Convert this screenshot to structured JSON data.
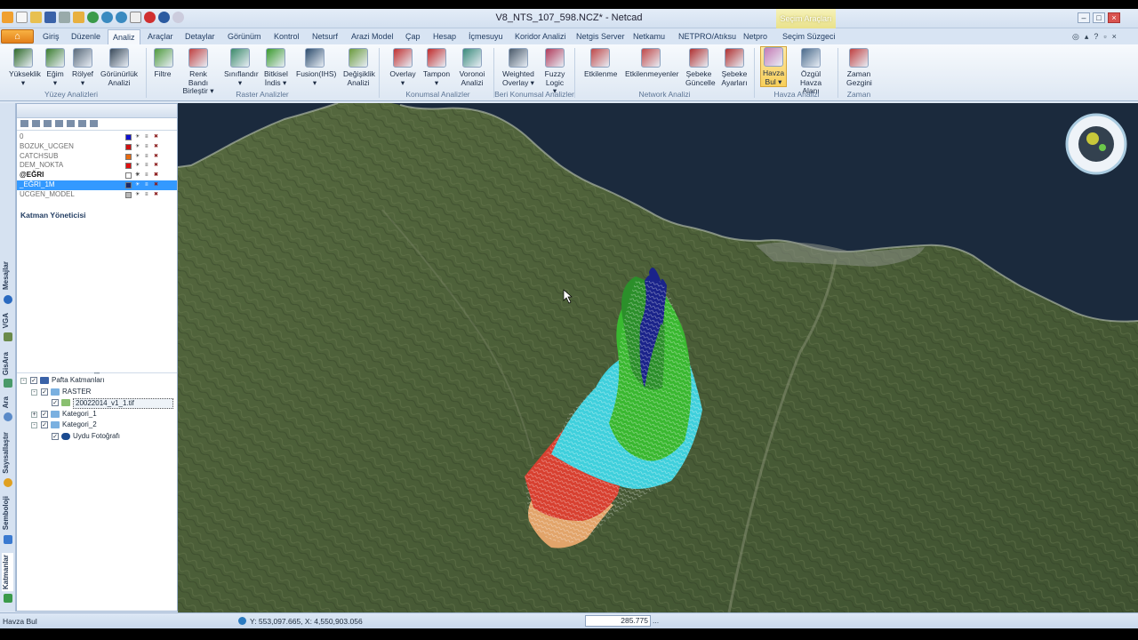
{
  "window": {
    "title": "V8_NTS_107_598.NCZ* - Netcad",
    "context_tab_group": "Seçim Araçları"
  },
  "ribbon": {
    "file_label": "⌂",
    "tabs": [
      "Giriş",
      "Düzenle",
      "Analiz",
      "Araçlar",
      "Detaylar",
      "Görünüm",
      "Kontrol",
      "Netsurf",
      "Arazi Model",
      "Çap",
      "Hesap",
      "İçmesuyu",
      "Koridor Analizi",
      "Netgis Server",
      "Netkamu",
      "NETPRO/Atıksu",
      "Netpro",
      "Seçim Süzgeci"
    ],
    "active_tab": "Analiz",
    "buttons": [
      {
        "label": "Yükseklik",
        "sub": "▾",
        "icon": "elevation-icon",
        "color": "#2f6a2a"
      },
      {
        "label": "Eğim",
        "sub": "▾",
        "icon": "slope-icon",
        "color": "#3b7d2f"
      },
      {
        "label": "Rölyef",
        "sub": "▾",
        "icon": "relief-icon",
        "color": "#5a6a7a"
      },
      {
        "label": "Görünürlük",
        "sub": "Analizi",
        "icon": "visibility-icon",
        "color": "#3a4a5a"
      },
      {
        "label": "Filtre",
        "sub": "",
        "icon": "filter-icon",
        "color": "#4f9a3c"
      },
      {
        "label": "Renk Bandı",
        "sub": "Birleştir ▾",
        "icon": "color-band-icon",
        "color": "#c04040"
      },
      {
        "label": "Sınıflandır",
        "sub": "▾",
        "icon": "classify-icon",
        "color": "#3c8a6a"
      },
      {
        "label": "Bitkisel",
        "sub": "İndis ▾",
        "icon": "vegetation-icon",
        "color": "#3a9a2c"
      },
      {
        "label": "Fusion(IHS)",
        "sub": "▾",
        "icon": "fusion-icon",
        "color": "#2c4c6c"
      },
      {
        "label": "Değişiklik",
        "sub": "Analizi",
        "icon": "change-icon",
        "color": "#6a9a3c"
      },
      {
        "label": "Overlay",
        "sub": "▾",
        "icon": "overlay-icon",
        "color": "#c03030"
      },
      {
        "label": "Tampon",
        "sub": "▾",
        "icon": "buffer-icon",
        "color": "#c02a2a"
      },
      {
        "label": "Voronoi",
        "sub": "Analizi",
        "icon": "voronoi-icon",
        "color": "#3a8a7a"
      },
      {
        "label": "Weighted",
        "sub": "Overlay ▾",
        "icon": "weighted-overlay-icon",
        "color": "#4a5a6a"
      },
      {
        "label": "Fuzzy",
        "sub": "Logic ▾",
        "icon": "fuzzy-logic-icon",
        "color": "#b03a5a"
      },
      {
        "label": "Etkilenme",
        "sub": "",
        "icon": "impact-icon",
        "color": "#c04848"
      },
      {
        "label": "Etkilenmeyenler",
        "sub": "",
        "icon": "unaffected-icon",
        "color": "#c04848"
      },
      {
        "label": "Şebeke",
        "sub": "Güncelle",
        "icon": "network-update-icon",
        "color": "#b03030"
      },
      {
        "label": "Şebeke",
        "sub": "Ayarları",
        "icon": "network-settings-icon",
        "color": "#b03030"
      },
      {
        "label": "Havza",
        "sub": "Bul ▾",
        "icon": "watershed-find-icon",
        "color": "#c57ab5"
      },
      {
        "label": "Özgül",
        "sub": "Havza Alanı",
        "icon": "specific-watershed-icon",
        "color": "#4a6a8a"
      },
      {
        "label": "Zaman",
        "sub": "Gezgini",
        "icon": "time-explorer-icon",
        "color": "#c04040"
      }
    ],
    "groups": [
      "Yüzey Analizleri",
      "Raster Analizler",
      "Konumsal Analizler",
      "Beri Konumsal Analizler",
      "Network Analizi",
      "Havza Analizi",
      "Zaman"
    ]
  },
  "side_tabs": [
    "Mesajlar",
    "VGA",
    "GisAra",
    "Ara",
    "Sayısallaştır",
    "Semboloji",
    "Katmanlar"
  ],
  "layer_panel": {
    "title": "Katman Yöneticisi",
    "layers": [
      {
        "name": "0",
        "color": "#1010d0",
        "style": "normal"
      },
      {
        "name": "BOZUK_UCGEN",
        "color": "#d01010",
        "style": "normal"
      },
      {
        "name": "CATCHSUB",
        "color": "#e86a10",
        "style": "normal"
      },
      {
        "name": "DEM_NOKTA",
        "color": "#e01010",
        "style": "normal"
      },
      {
        "name": "@EĞRI",
        "color": "#ffffff",
        "style": "bold"
      },
      {
        "name": "_EĞRI_1M",
        "color": "#1a2a6a",
        "style": "selected"
      },
      {
        "name": "UCGEN_MODEL",
        "color": "#b8b8b8",
        "style": "normal"
      }
    ],
    "tree": [
      {
        "label": "Pafta Katmanları",
        "level": 0,
        "expander": "-",
        "checked": true,
        "icon": "raster-layer-icon"
      },
      {
        "label": "RASTER",
        "level": 1,
        "expander": "-",
        "checked": true,
        "icon": "folder-icon"
      },
      {
        "label": "20022014_v1_1.tif",
        "level": 2,
        "expander": "",
        "checked": true,
        "icon": "image-icon",
        "highlight": true
      },
      {
        "label": "Kategori_1",
        "level": 1,
        "expander": "+",
        "checked": true,
        "icon": "folder-icon"
      },
      {
        "label": "Kategori_2",
        "level": 1,
        "expander": "-",
        "checked": true,
        "icon": "folder-icon"
      },
      {
        "label": "Uydu Fotoğrafı",
        "level": 2,
        "expander": "",
        "checked": true,
        "icon": "globe-icon"
      }
    ]
  },
  "status": {
    "mode": "Havza Bul",
    "coordinates": "Y: 553,097.665, X: 4,550,903.056",
    "scale": "285.775",
    "ellipsis": "..."
  },
  "colors": {
    "accent": "#3399ff",
    "sea": "#1b2a3d",
    "terrain": "#4c5e3b"
  }
}
